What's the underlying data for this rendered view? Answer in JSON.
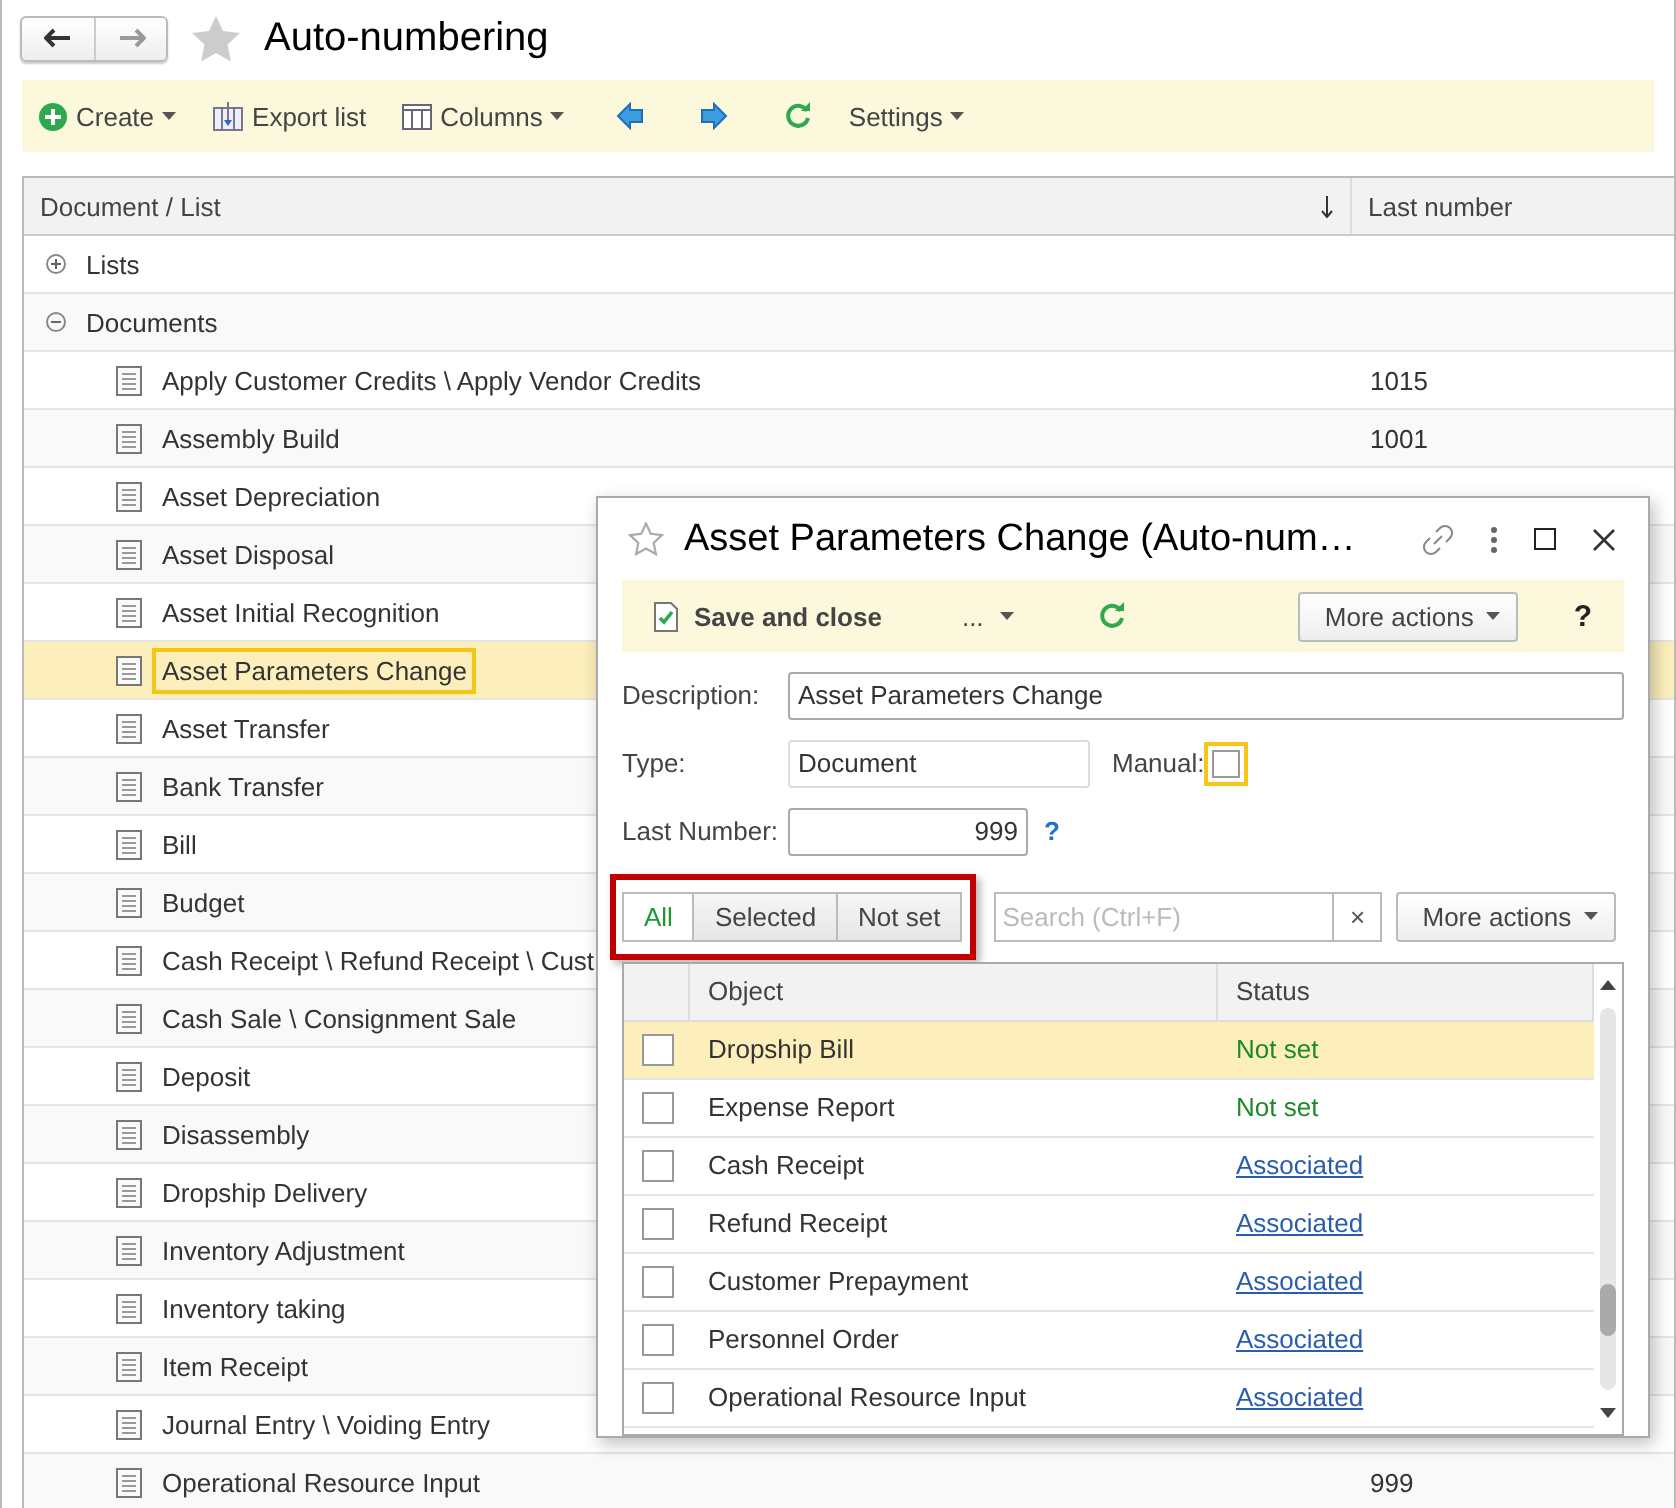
{
  "window": {
    "title": "Auto-numbering"
  },
  "toolbar": [
    {
      "kind": "create",
      "label": "Create",
      "dropdown": true
    },
    {
      "kind": "export",
      "label": "Export list",
      "dropdown": false
    },
    {
      "kind": "columns",
      "label": "Columns",
      "dropdown": true
    },
    {
      "kind": "back",
      "dropdown": false
    },
    {
      "kind": "forward",
      "dropdown": false
    },
    {
      "kind": "refresh",
      "dropdown": false
    },
    {
      "kind": "settings",
      "label": "Settings",
      "dropdown": true
    }
  ],
  "table": {
    "columns": [
      "Document / List",
      "Last number"
    ],
    "rows": [
      {
        "name": "Lists",
        "expanded": false,
        "selected": false
      },
      {
        "name": "Documents",
        "expanded": true,
        "selected": false,
        "children": [
          {
            "name": "Apply Customer Credits \\ Apply Vendor Credits",
            "last_number": "1015",
            "selected": false
          },
          {
            "name": "Assembly Build",
            "last_number": "1001",
            "selected": false
          },
          {
            "name": "Asset Depreciation",
            "selected": false
          },
          {
            "name": "Asset Disposal",
            "selected": false
          },
          {
            "name": "Asset Initial Recognition",
            "selected": false
          },
          {
            "name": "Asset Parameters Change",
            "selected": true
          },
          {
            "name": "Asset Transfer",
            "selected": false
          },
          {
            "name": "Bank Transfer",
            "selected": false
          },
          {
            "name": "Bill",
            "selected": false
          },
          {
            "name": "Budget",
            "selected": false
          },
          {
            "name": "Cash Receipt \\ Refund Receipt \\ Cust",
            "selected": false
          },
          {
            "name": "Cash Sale \\ Consignment Sale",
            "selected": false
          },
          {
            "name": "Deposit",
            "selected": false
          },
          {
            "name": "Disassembly",
            "selected": false
          },
          {
            "name": "Dropship Delivery",
            "selected": false
          },
          {
            "name": "Inventory Adjustment",
            "selected": false
          },
          {
            "name": "Inventory taking",
            "selected": false
          },
          {
            "name": "Item Receipt",
            "selected": false
          },
          {
            "name": "Journal Entry \\ Voiding Entry",
            "selected": false
          },
          {
            "name": "Operational Resource Input",
            "last_number": "999",
            "selected": false
          }
        ]
      }
    ]
  },
  "dialog": {
    "title": "Asset Parameters Change (Auto-num…",
    "toolbar": {
      "save": "Save and close",
      "menu": "...",
      "more_actions": "More actions",
      "help": "?"
    },
    "description": {
      "label": "Description:",
      "value": "Asset Parameters Change"
    },
    "type": {
      "label": "Type:",
      "value": "Document"
    },
    "manual": {
      "label": "Manual:",
      "checked": false
    },
    "last_number": {
      "label": "Last Number:",
      "value": "999",
      "help": "?"
    },
    "filter_tabs": [
      {
        "label": "All",
        "selected": true
      },
      {
        "label": "Selected",
        "selected": false
      },
      {
        "label": "Not set",
        "selected": false
      }
    ],
    "search": {
      "placeholder": "Search (Ctrl+F)",
      "clear": "×"
    },
    "more_actions": "More actions",
    "table": {
      "columns": [
        "Object",
        "Status"
      ],
      "rows": [
        {
          "object": "Dropship Bill",
          "status": "Not set",
          "kind": "not_set",
          "checked": false,
          "selected": true
        },
        {
          "object": "Expense Report",
          "status": "Not set",
          "kind": "not_set",
          "checked": false,
          "selected": false
        },
        {
          "object": "Cash Receipt",
          "status": "Associated",
          "kind": "associated",
          "checked": false,
          "selected": false
        },
        {
          "object": "Refund Receipt",
          "status": "Associated",
          "kind": "associated",
          "checked": false,
          "selected": false
        },
        {
          "object": "Customer Prepayment",
          "status": "Associated",
          "kind": "associated",
          "checked": false,
          "selected": false
        },
        {
          "object": "Personnel Order",
          "status": "Associated",
          "kind": "associated",
          "checked": false,
          "selected": false
        },
        {
          "object": "Operational Resource Input",
          "status": "Associated",
          "kind": "associated",
          "checked": false,
          "selected": false
        }
      ]
    }
  }
}
